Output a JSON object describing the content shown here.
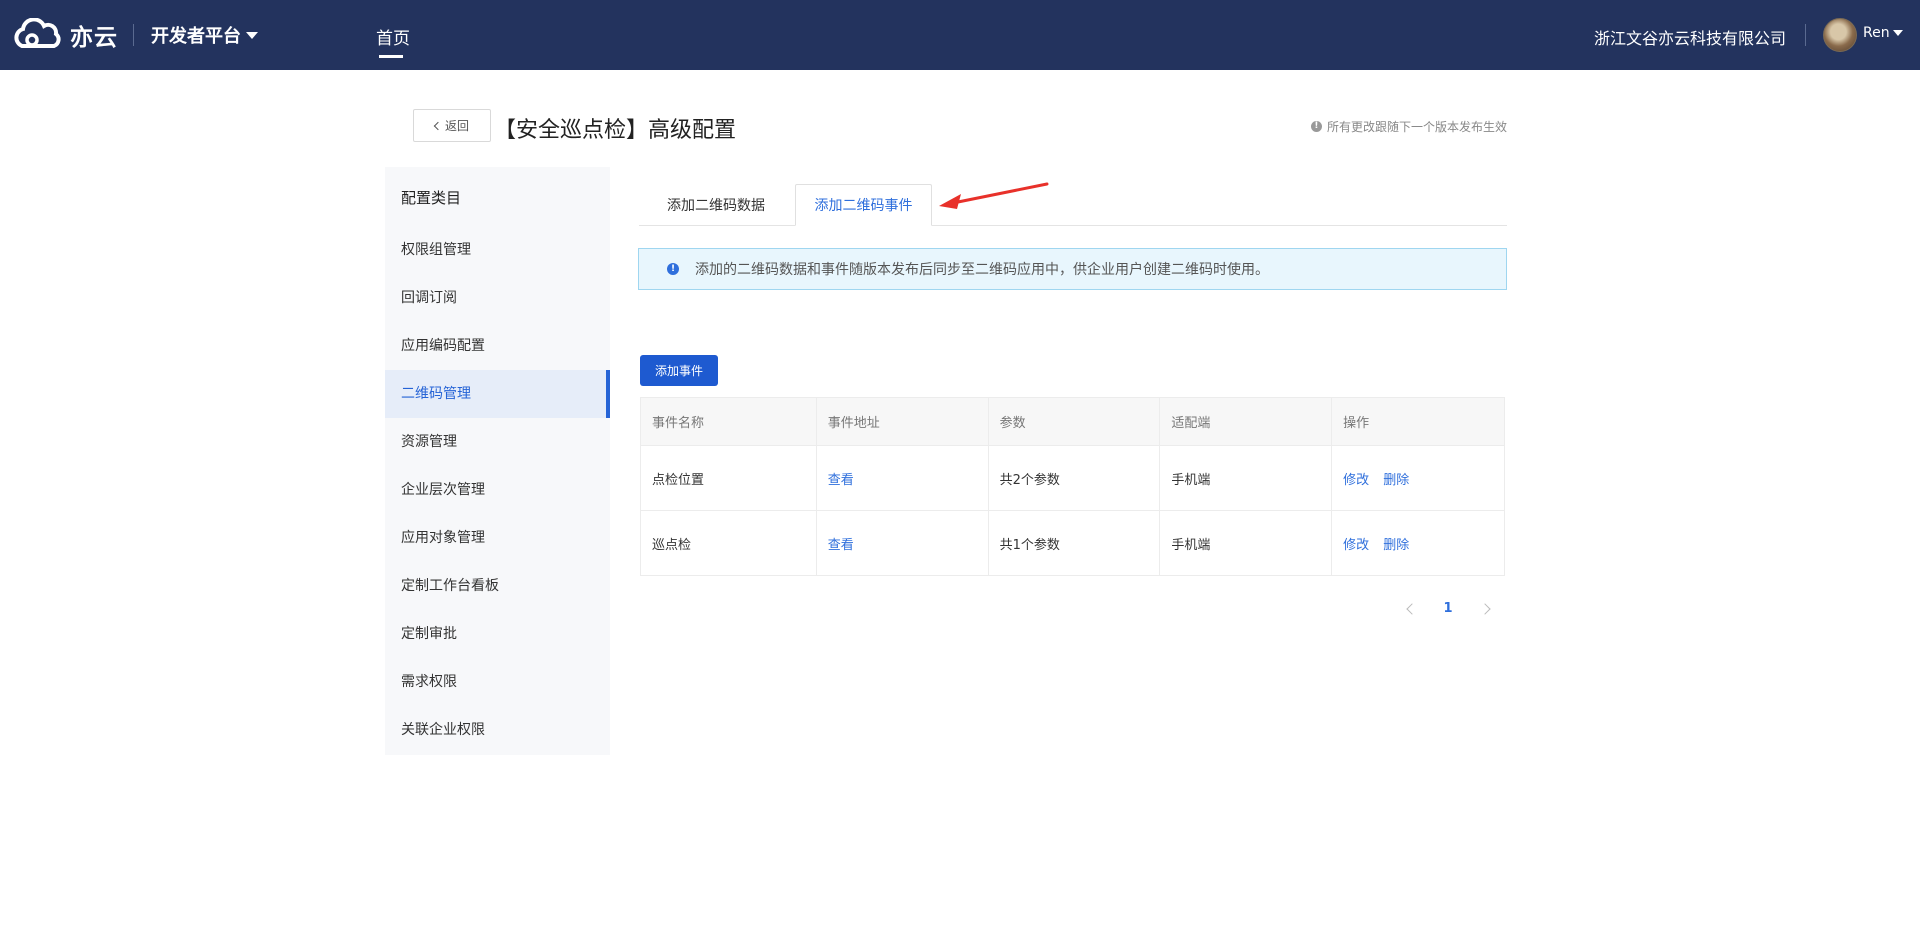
{
  "topbar": {
    "logo_text": "亦云",
    "platform": "开发者平台",
    "nav_home": "首页",
    "company": "浙江文谷亦云科技有限公司",
    "user": "Ren"
  },
  "header": {
    "back_label": "返回",
    "title": "【安全巡点检】高级配置",
    "notice": "所有更改跟随下一个版本发布生效"
  },
  "sidebar": {
    "title": "配置类目",
    "items": [
      {
        "label": "权限组管理"
      },
      {
        "label": "回调订阅"
      },
      {
        "label": "应用编码配置"
      },
      {
        "label": "二维码管理",
        "active": true
      },
      {
        "label": "资源管理"
      },
      {
        "label": "企业层次管理"
      },
      {
        "label": "应用对象管理"
      },
      {
        "label": "定制工作台看板"
      },
      {
        "label": "定制审批"
      },
      {
        "label": "需求权限"
      },
      {
        "label": "关联企业权限"
      }
    ]
  },
  "tabs": [
    {
      "label": "添加二维码数据",
      "active": false
    },
    {
      "label": "添加二维码事件",
      "active": true
    }
  ],
  "info": "添加的二维码数据和事件随版本发布后同步至二维码应用中，供企业用户创建二维码时使用。",
  "add_button": "添加事件",
  "table": {
    "columns": [
      "事件名称",
      "事件地址",
      "参数",
      "适配端",
      "操作"
    ],
    "rows": [
      {
        "name": "点检位置",
        "address": "查看",
        "params": "共2个参数",
        "platform": "手机端",
        "edit": "修改",
        "delete": "删除"
      },
      {
        "name": "巡点检",
        "address": "查看",
        "params": "共1个参数",
        "platform": "手机端",
        "edit": "修改",
        "delete": "删除"
      }
    ]
  },
  "pagination": {
    "current": "1"
  },
  "colors": {
    "topbar": "#23335e",
    "accent": "#2f6fdc",
    "primary_button": "#1e5ad0",
    "annotation_arrow": "#e8312a"
  }
}
